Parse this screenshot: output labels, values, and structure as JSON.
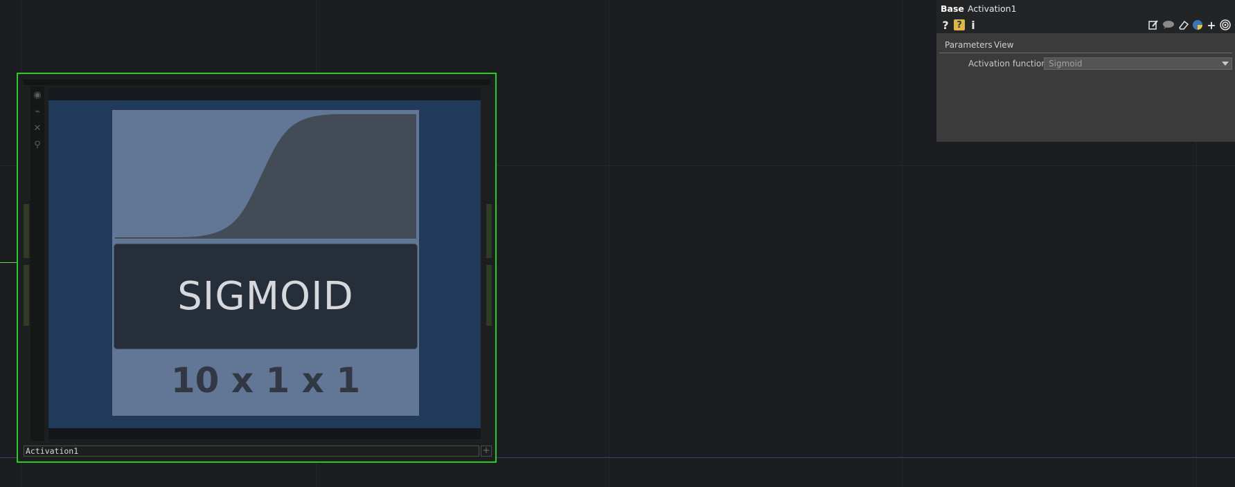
{
  "panel": {
    "op_type": "Base",
    "op_name": "Activation1",
    "icons": [
      "question-icon",
      "help-book-icon",
      "info-icon",
      "edit-icon",
      "comment-icon",
      "eraser-icon",
      "python-icon",
      "plus-icon",
      "target-icon"
    ],
    "icon_glyphs": {
      "question": "?",
      "help": "?",
      "info": "i",
      "plus": "+"
    },
    "tabs": [
      "Parameters",
      "View"
    ],
    "parameter": {
      "label": "Activation function",
      "value": "Sigmoid"
    }
  },
  "node": {
    "name": "Activation1",
    "add_glyph": "+",
    "viewer": {
      "title": "SIGMOID",
      "dims": "10 x 1 x 1"
    },
    "tools": [
      "bypass-icon",
      "graph-icon",
      "close-icon",
      "lock-icon"
    ],
    "tool_glyphs": [
      "◉",
      "⌁",
      "✕",
      "⚲"
    ]
  },
  "colors": {
    "background": "#1b1d21",
    "selection": "#22d11e",
    "viewer_bg": "#223a5a",
    "card_bg": "#627795",
    "panel_bg": "#3b3b3b",
    "help_icon": "#e0b540"
  }
}
